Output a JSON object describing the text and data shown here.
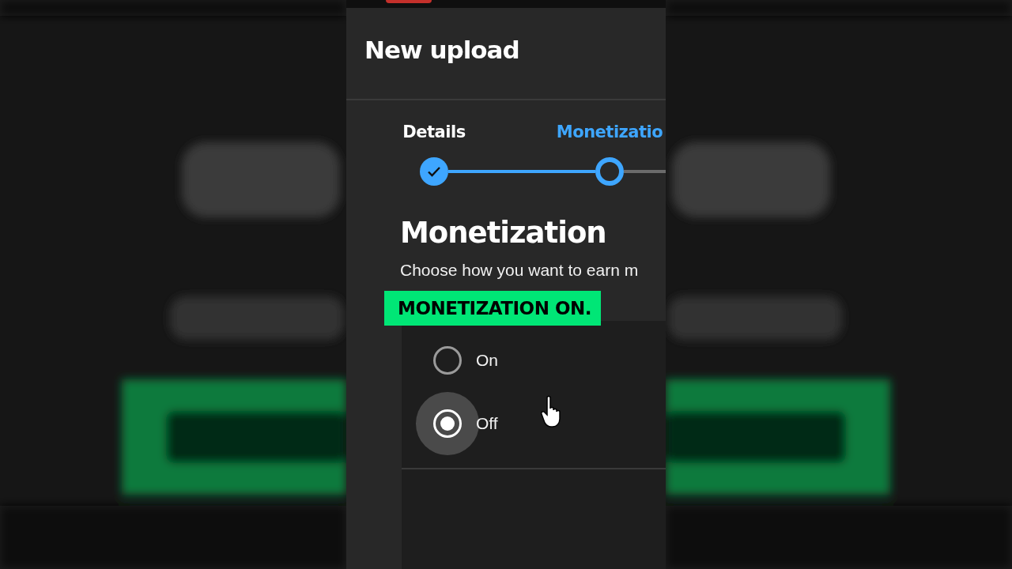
{
  "header": {
    "title": "New upload"
  },
  "stepper": [
    {
      "label": "Details",
      "completed": true,
      "selected": false
    },
    {
      "label": "Monetizatio",
      "completed": false,
      "selected": true
    }
  ],
  "section": {
    "title": "Monetization",
    "description": "Choose how you want to earn m"
  },
  "caption": "MONETIZATION ON.",
  "options": [
    {
      "label": "On",
      "selected": false
    },
    {
      "label": "Off",
      "selected": true
    }
  ]
}
